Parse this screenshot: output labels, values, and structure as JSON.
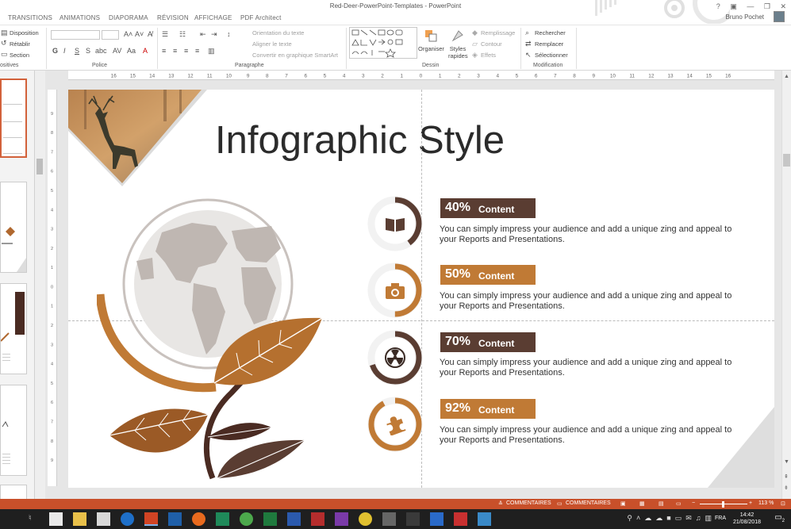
{
  "window": {
    "title": "Red-Deer-PowerPoint-Templates - PowerPoint",
    "user": "Bruno Pochet",
    "controls": [
      "?",
      "▣",
      "—",
      "❐",
      "✕"
    ]
  },
  "tabs": [
    "TRANSITIONS",
    "ANIMATIONS",
    "DIAPORAMA",
    "RÉVISION",
    "AFFICHAGE",
    "PDF Architect"
  ],
  "ribbon": {
    "slides": {
      "items": [
        "Disposition",
        "Rétablir",
        "Section"
      ],
      "label": "ositives"
    },
    "font": {
      "label": "Police"
    },
    "paragraph": {
      "label": "Paragraphe",
      "commands": [
        "Orientation du texte",
        "Aligner le texte",
        "Convertir en graphique SmartArt"
      ]
    },
    "drawing": {
      "label": "Dessin",
      "organize": "Organiser",
      "styles": "Styles rapides",
      "commands": [
        "Remplissage",
        "Contour",
        "Effets"
      ]
    },
    "editing": {
      "label": "Modification",
      "commands": [
        "Rechercher",
        "Remplacer",
        "Sélectionner"
      ]
    }
  },
  "ruler": {
    "h_ticks": [
      "16",
      "15",
      "14",
      "13",
      "12",
      "11",
      "10",
      "9",
      "8",
      "7",
      "6",
      "5",
      "4",
      "3",
      "2",
      "1",
      "0",
      "1",
      "2",
      "3",
      "4",
      "5",
      "6",
      "7",
      "8",
      "9",
      "10",
      "11",
      "12",
      "13",
      "14",
      "15",
      "16"
    ],
    "v_ticks": [
      "9",
      "8",
      "7",
      "6",
      "5",
      "4",
      "3",
      "2",
      "1",
      "0",
      "1",
      "2",
      "3",
      "4",
      "5",
      "6",
      "7",
      "8",
      "9"
    ]
  },
  "slide": {
    "title": "Infographic Style",
    "items": [
      {
        "percent": "40%",
        "label": "Content",
        "percent_value": 40,
        "color": "#5a3d32",
        "icon": "book-icon",
        "description_lines": [
          "You can simply impress your audience and add a unique zing and appeal to",
          "your Reports and Presentations."
        ]
      },
      {
        "percent": "50%",
        "label": "Content",
        "percent_value": 50,
        "color": "#c07a35",
        "icon": "camera-icon",
        "description_lines": [
          "You can simply impress your audience and add a unique zing and appeal to",
          "your Reports and Presentations."
        ]
      },
      {
        "percent": "70%",
        "label": "Content",
        "percent_value": 70,
        "color": "#5a3d32",
        "icon": "radiation-icon",
        "description_lines": [
          "You can simply impress your audience and add a unique zing and appeal to",
          "your Reports and Presentations."
        ]
      },
      {
        "percent": "92%",
        "label": "Content",
        "percent_value": 92,
        "color": "#c07a35",
        "icon": "puzzle-icon",
        "description_lines": [
          "You can simply impress your audience and add a unique zing and appeal to",
          "your Reports and Presentations."
        ]
      }
    ]
  },
  "statusbar": {
    "notes": "COMMENTAIRES",
    "comments": "COMMENTAIRES",
    "zoom": "113 %"
  },
  "taskbar": {
    "language": "FRA",
    "time": "14:42",
    "date": "21/08/2018",
    "notification_count": "2"
  },
  "colors": {
    "dark_brown": "#5a3d32",
    "orange_brown": "#c07a35",
    "status_bar": "#c8502a"
  }
}
